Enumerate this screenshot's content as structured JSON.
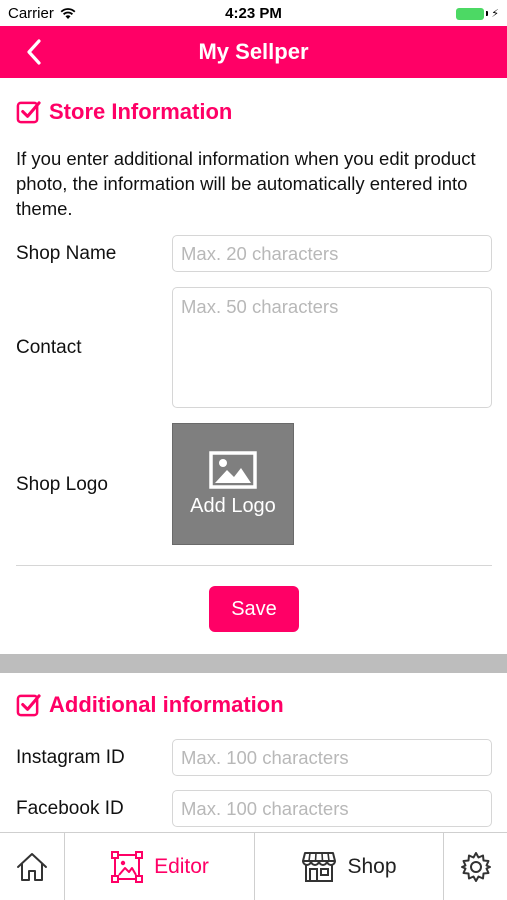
{
  "status_bar": {
    "carrier": "Carrier",
    "time": "4:23 PM"
  },
  "nav": {
    "title": "My Sellper"
  },
  "store_section": {
    "title": "Store Information",
    "description": "If you enter additional information when you edit product photo, the information will be automatically entered into theme.",
    "shop_name_label": "Shop Name",
    "shop_name_placeholder": "Max. 20 characters",
    "contact_label": "Contact",
    "contact_placeholder": "Max. 50 characters",
    "shop_logo_label": "Shop Logo",
    "add_logo_label": "Add Logo",
    "save_label": "Save"
  },
  "additional_section": {
    "title": "Additional information",
    "instagram_label": "Instagram ID",
    "instagram_placeholder": "Max. 100 characters",
    "facebook_label": "Facebook ID",
    "facebook_placeholder": "Max. 100 characters"
  },
  "tab_bar": {
    "editor_label": "Editor",
    "shop_label": "Shop"
  },
  "colors": {
    "accent": "#ff0066",
    "logo_box": "#7f7f7f",
    "band": "#bdbdbd"
  }
}
